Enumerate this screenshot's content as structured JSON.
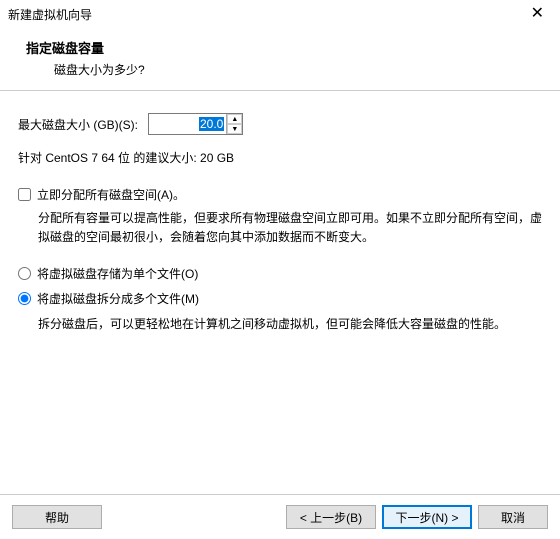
{
  "window": {
    "title": "新建虚拟机向导"
  },
  "header": {
    "title": "指定磁盘容量",
    "subtitle": "磁盘大小为多少?"
  },
  "disk": {
    "size_label": "最大磁盘大小 (GB)(S):",
    "size_value": "20.0",
    "recommend": "针对 CentOS 7 64 位 的建议大小: 20 GB"
  },
  "allocate": {
    "checkbox_label": "立即分配所有磁盘空间(A)。",
    "description": "分配所有容量可以提高性能，但要求所有物理磁盘空间立即可用。如果不立即分配所有空间，虚拟磁盘的空间最初很小，会随着您向其中添加数据而不断变大。"
  },
  "store": {
    "single_label": "将虚拟磁盘存储为单个文件(O)",
    "split_label": "将虚拟磁盘拆分成多个文件(M)",
    "split_description": "拆分磁盘后，可以更轻松地在计算机之间移动虚拟机，但可能会降低大容量磁盘的性能。"
  },
  "buttons": {
    "help": "帮助",
    "back": "< 上一步(B)",
    "next": "下一步(N) >",
    "cancel": "取消"
  }
}
